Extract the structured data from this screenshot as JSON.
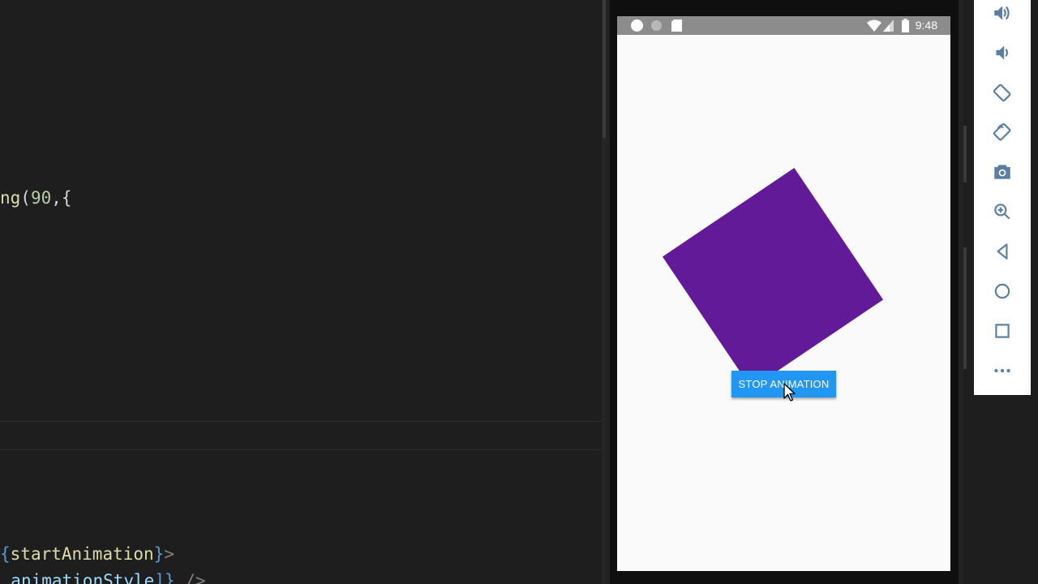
{
  "colors": {
    "editor_bg": "#1e1e1e",
    "method": "#dcdcaa",
    "punct": "#d4d4d4",
    "number": "#b5cea8",
    "brace": "#569cd6",
    "variable": "#9cdcfe",
    "square": "#621a98",
    "button": "#2196f3",
    "icon": "#5b7ea3"
  },
  "editor": {
    "lines": [
      {
        "segments": [
          {
            "text": "ng",
            "color": "#dcdcaa"
          },
          {
            "text": "(",
            "color": "#d4d4d4"
          },
          {
            "text": "90",
            "color": "#b5cea8"
          },
          {
            "text": ",{",
            "color": "#d4d4d4"
          }
        ]
      },
      {
        "segments": [
          {
            "text": "{",
            "color": "#569cd6"
          },
          {
            "text": "startAnimation",
            "color": "#dcdcaa"
          },
          {
            "text": "}",
            "color": "#569cd6"
          },
          {
            "text": ">",
            "color": "#808080"
          }
        ]
      },
      {
        "segments": [
          {
            "text": ", ",
            "color": "#d4d4d4"
          },
          {
            "text": "animationStyle",
            "color": "#9cdcfe"
          },
          {
            "text": "]}",
            "color": "#569cd6"
          },
          {
            "text": " />",
            "color": "#808080"
          }
        ]
      }
    ]
  },
  "emulator": {
    "status_time": "9:48",
    "stop_button_label": "STOP ANIMATION",
    "status_icons": [
      "circle-icon",
      "circle-icon",
      "sd-card-icon",
      "wifi-icon",
      "signal-icon",
      "battery-icon"
    ]
  },
  "toolbar": {
    "buttons": [
      {
        "name": "volume-up-icon"
      },
      {
        "name": "volume-down-icon"
      },
      {
        "name": "rotate-left-icon"
      },
      {
        "name": "rotate-right-icon"
      },
      {
        "name": "camera-icon"
      },
      {
        "name": "zoom-icon"
      },
      {
        "name": "back-icon"
      },
      {
        "name": "home-icon"
      },
      {
        "name": "overview-icon"
      },
      {
        "name": "more-icon"
      }
    ]
  }
}
